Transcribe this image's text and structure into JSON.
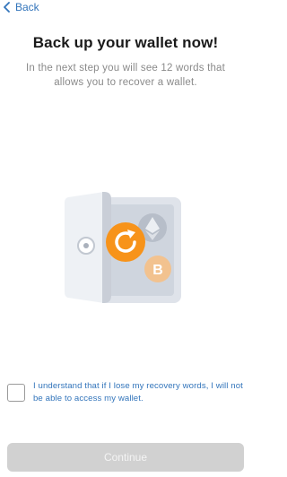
{
  "nav": {
    "back_label": "Back"
  },
  "header": {
    "title": "Back up your wallet now!",
    "subtitle": "In the next step you will see 12 words that allows you to recover a wallet."
  },
  "illustration": {
    "icons": [
      "safe-icon",
      "ethereum-icon",
      "bitcoin-icon",
      "refresh-icon"
    ],
    "accent_color": "#f7931a"
  },
  "consent": {
    "checked": false,
    "text": "I understand that if I lose my recovery words, I will not be able to access my wallet."
  },
  "footer": {
    "continue_label": "Continue",
    "continue_enabled": false
  },
  "colors": {
    "link_blue": "#3375bb",
    "disabled_button": "#d1d1d1"
  }
}
